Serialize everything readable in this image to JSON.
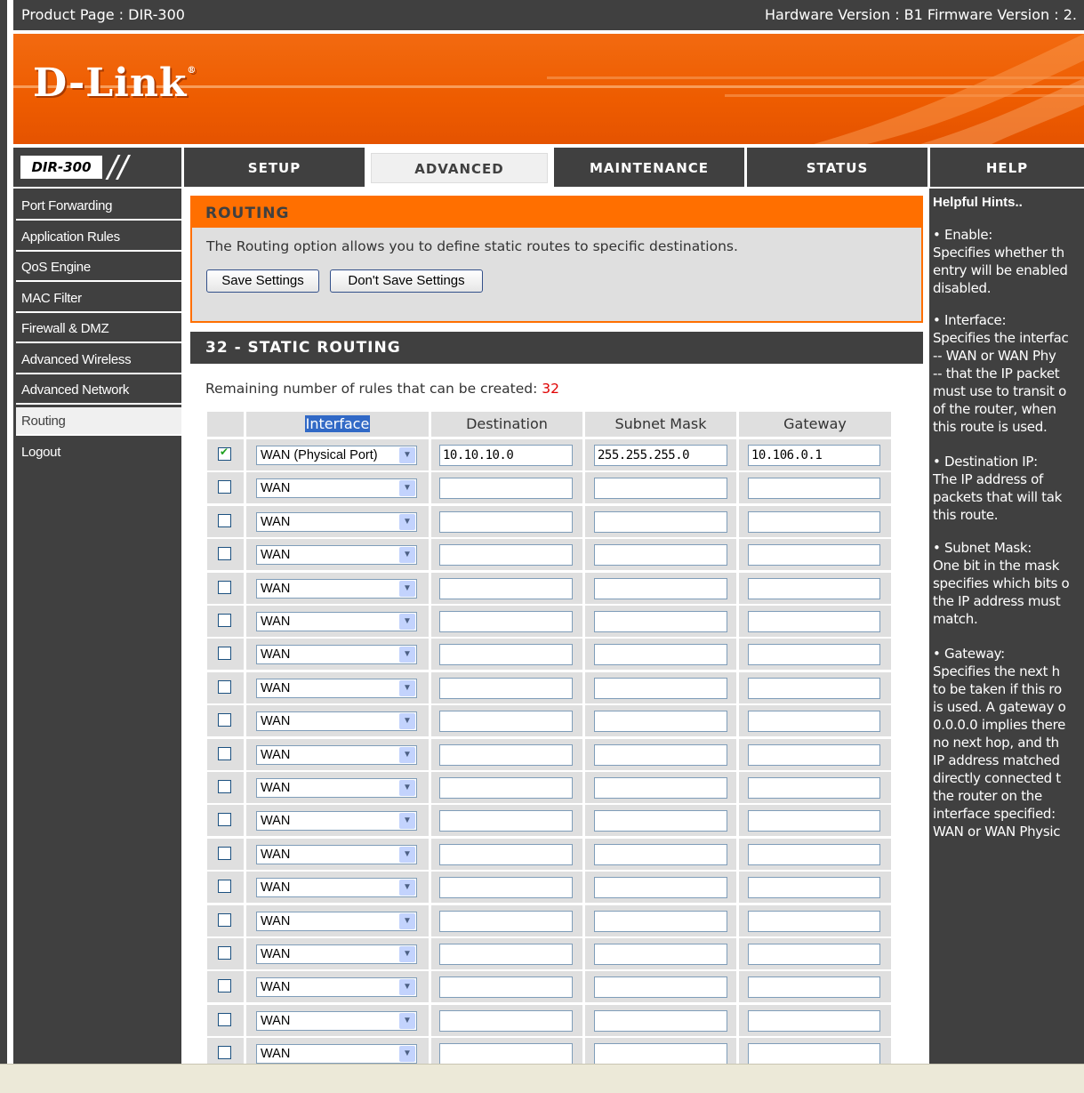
{
  "topbar": {
    "product": "Product Page : DIR-300",
    "versions": "Hardware Version : B1   Firmware Version : 2."
  },
  "brand": {
    "logo": "D-Link",
    "model": "DIR-300"
  },
  "tabs": [
    {
      "label": "SETUP"
    },
    {
      "label": "ADVANCED"
    },
    {
      "label": "MAINTENANCE"
    },
    {
      "label": "STATUS"
    },
    {
      "label": "HELP"
    }
  ],
  "sidebar": {
    "items": [
      {
        "label": "Port Forwarding"
      },
      {
        "label": "Application Rules"
      },
      {
        "label": "QoS Engine"
      },
      {
        "label": "MAC Filter"
      },
      {
        "label": "Firewall & DMZ"
      },
      {
        "label": "Advanced Wireless"
      },
      {
        "label": "Advanced Network"
      },
      {
        "label": "Routing"
      },
      {
        "label": "Logout"
      }
    ]
  },
  "routing": {
    "title": "ROUTING",
    "description": "The Routing option allows you to define static routes to specific destinations.",
    "save_label": "Save Settings",
    "dont_save_label": "Don't Save Settings"
  },
  "static_routing": {
    "title": "32 - STATIC ROUTING",
    "remaining_label": "Remaining number of rules that can be created:",
    "remaining_value": "32",
    "columns": [
      "Interface",
      "Destination",
      "Subnet Mask",
      "Gateway"
    ],
    "rows": [
      {
        "checked": true,
        "interface": "WAN (Physical Port)",
        "destination": "10.10.10.0",
        "subnet": "255.255.255.0",
        "gateway": "10.106.0.1"
      },
      {
        "checked": false,
        "interface": "WAN",
        "destination": "",
        "subnet": "",
        "gateway": ""
      },
      {
        "checked": false,
        "interface": "WAN",
        "destination": "",
        "subnet": "",
        "gateway": ""
      },
      {
        "checked": false,
        "interface": "WAN",
        "destination": "",
        "subnet": "",
        "gateway": ""
      },
      {
        "checked": false,
        "interface": "WAN",
        "destination": "",
        "subnet": "",
        "gateway": ""
      },
      {
        "checked": false,
        "interface": "WAN",
        "destination": "",
        "subnet": "",
        "gateway": ""
      },
      {
        "checked": false,
        "interface": "WAN",
        "destination": "",
        "subnet": "",
        "gateway": ""
      },
      {
        "checked": false,
        "interface": "WAN",
        "destination": "",
        "subnet": "",
        "gateway": ""
      },
      {
        "checked": false,
        "interface": "WAN",
        "destination": "",
        "subnet": "",
        "gateway": ""
      },
      {
        "checked": false,
        "interface": "WAN",
        "destination": "",
        "subnet": "",
        "gateway": ""
      },
      {
        "checked": false,
        "interface": "WAN",
        "destination": "",
        "subnet": "",
        "gateway": ""
      },
      {
        "checked": false,
        "interface": "WAN",
        "destination": "",
        "subnet": "",
        "gateway": ""
      },
      {
        "checked": false,
        "interface": "WAN",
        "destination": "",
        "subnet": "",
        "gateway": ""
      },
      {
        "checked": false,
        "interface": "WAN",
        "destination": "",
        "subnet": "",
        "gateway": ""
      },
      {
        "checked": false,
        "interface": "WAN",
        "destination": "",
        "subnet": "",
        "gateway": ""
      },
      {
        "checked": false,
        "interface": "WAN",
        "destination": "",
        "subnet": "",
        "gateway": ""
      },
      {
        "checked": false,
        "interface": "WAN",
        "destination": "",
        "subnet": "",
        "gateway": ""
      },
      {
        "checked": false,
        "interface": "WAN",
        "destination": "",
        "subnet": "",
        "gateway": ""
      },
      {
        "checked": false,
        "interface": "WAN",
        "destination": "",
        "subnet": "",
        "gateway": ""
      }
    ]
  },
  "help": {
    "title": "Helpful Hints..",
    "hints": [
      "• Enable:\nSpecifies whether th\nentry will be enabled\ndisabled.",
      "• Interface:\nSpecifies the interfac\n-- WAN or WAN Phy\n-- that the IP packet\nmust use to transit o\nof the router, when\nthis route is used.",
      "• Destination IP:\nThe IP address of\npackets that will tak\nthis route.",
      "• Subnet Mask:\nOne bit in the mask\nspecifies which bits o\nthe IP address must\nmatch.",
      "• Gateway:\nSpecifies the next h\nto be taken if this ro\nis used. A gateway o\n0.0.0.0 implies there\nno next hop, and th\nIP address matched\ndirectly connected t\nthe router on the\ninterface specified:\nWAN or WAN Physic"
    ]
  },
  "colors": {
    "accent": "#ff6f00",
    "dark": "#404040",
    "panel": "#dfdfdf",
    "remaining": "#e00000"
  }
}
